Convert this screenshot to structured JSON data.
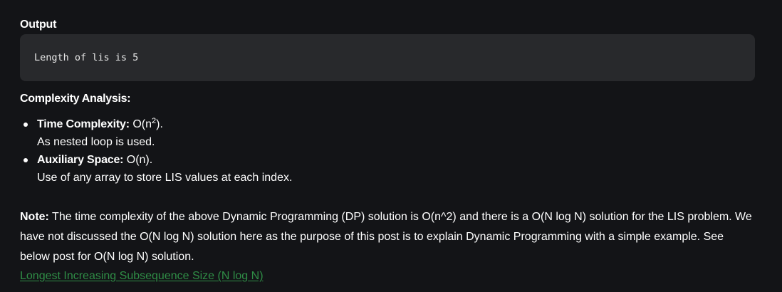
{
  "output": {
    "heading": "Output",
    "code": "Length of lis is 5"
  },
  "complexity": {
    "heading": "Complexity Analysis:",
    "items": [
      {
        "label": "Time Complexity:",
        "value_prefix": " O(n",
        "value_sup": "2",
        "value_suffix": ").",
        "detail": "As nested loop is used."
      },
      {
        "label": "Auxiliary Space:",
        "value": " O(n).",
        "detail": "Use of any array to store LIS values at each index."
      }
    ]
  },
  "note": {
    "label": "Note:",
    "text": " The time complexity of the above Dynamic Programming (DP) solution is O(n^2) and there is a O(N log N) solution for the LIS problem. We have not discussed the O(N log N) solution here as the purpose of this post is to explain Dynamic Programming with a simple example. See below post for O(N log N) solution."
  },
  "link": {
    "text": "Longest Increasing Subsequence Size (N log N)",
    "color": "#2f8d46"
  },
  "colors": {
    "background": "#131417",
    "code_background": "#28292c",
    "text": "#ffffff"
  }
}
